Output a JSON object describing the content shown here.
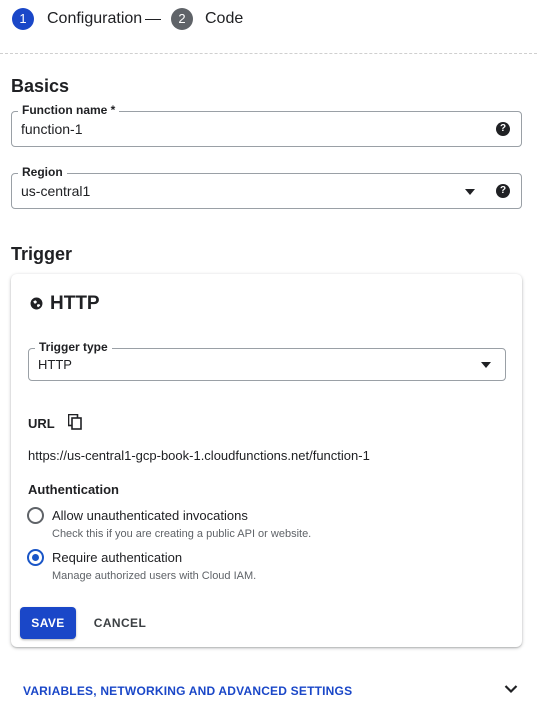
{
  "stepper": {
    "steps": [
      {
        "number": "1",
        "label": "Configuration",
        "state": "active",
        "color": "#1a47c8"
      },
      {
        "number": "2",
        "label": "Code",
        "state": "inactive",
        "color": "#5f6368"
      }
    ]
  },
  "basics": {
    "title": "Basics",
    "function_name": {
      "label": "Function name *",
      "value": "function-1",
      "icon": "help-icon"
    },
    "region": {
      "label": "Region",
      "value": "us-central1",
      "icons": [
        "caret-down-icon",
        "help-icon"
      ]
    }
  },
  "trigger": {
    "title": "Trigger",
    "card_title": "HTTP",
    "card_icon": "globe-icon",
    "trigger_type": {
      "label": "Trigger type",
      "value": "HTTP"
    },
    "url_label": "URL",
    "url_icon": "copy-icon",
    "url": "https://us-central1-gcp-book-1.cloudfunctions.net/function-1",
    "authentication": {
      "title": "Authentication",
      "options": [
        {
          "label": "Allow unauthenticated invocations",
          "description": "Check this if you are creating a public API or website.",
          "checked": false
        },
        {
          "label": "Require authentication",
          "description": "Manage authorized users with Cloud IAM.",
          "checked": true
        }
      ]
    },
    "save_label": "SAVE",
    "cancel_label": "CANCEL"
  },
  "advanced": {
    "label": "VARIABLES, NETWORKING AND ADVANCED SETTINGS",
    "icon": "chevron-down-icon"
  },
  "colors": {
    "accent": "#1a47c8",
    "radio_selected": "#1a56c7",
    "text": "#202124",
    "secondary_text": "#5f6368"
  }
}
